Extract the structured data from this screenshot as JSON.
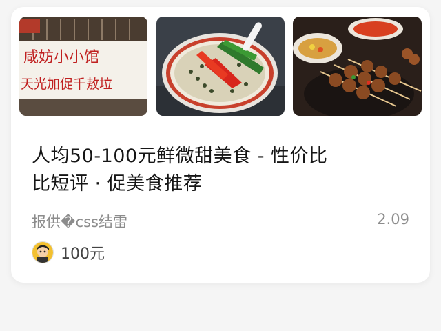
{
  "card": {
    "title_line1": "人均50-100元鲜微甜美食 - 性价比",
    "title_line2": "比短评 · 促美食推荐",
    "meta_label": "报供�css结雷",
    "meta_value": "2.09",
    "price": "100元",
    "images": {
      "shop_sign_line1": "咸妨小小馆",
      "shop_sign_line2": "天光加促千敖垃"
    }
  },
  "icons": {
    "avatar": "user-avatar-icon"
  },
  "colors": {
    "sign_text": "#c02020",
    "title_text": "#161616",
    "meta_text": "#8c8c8c"
  }
}
